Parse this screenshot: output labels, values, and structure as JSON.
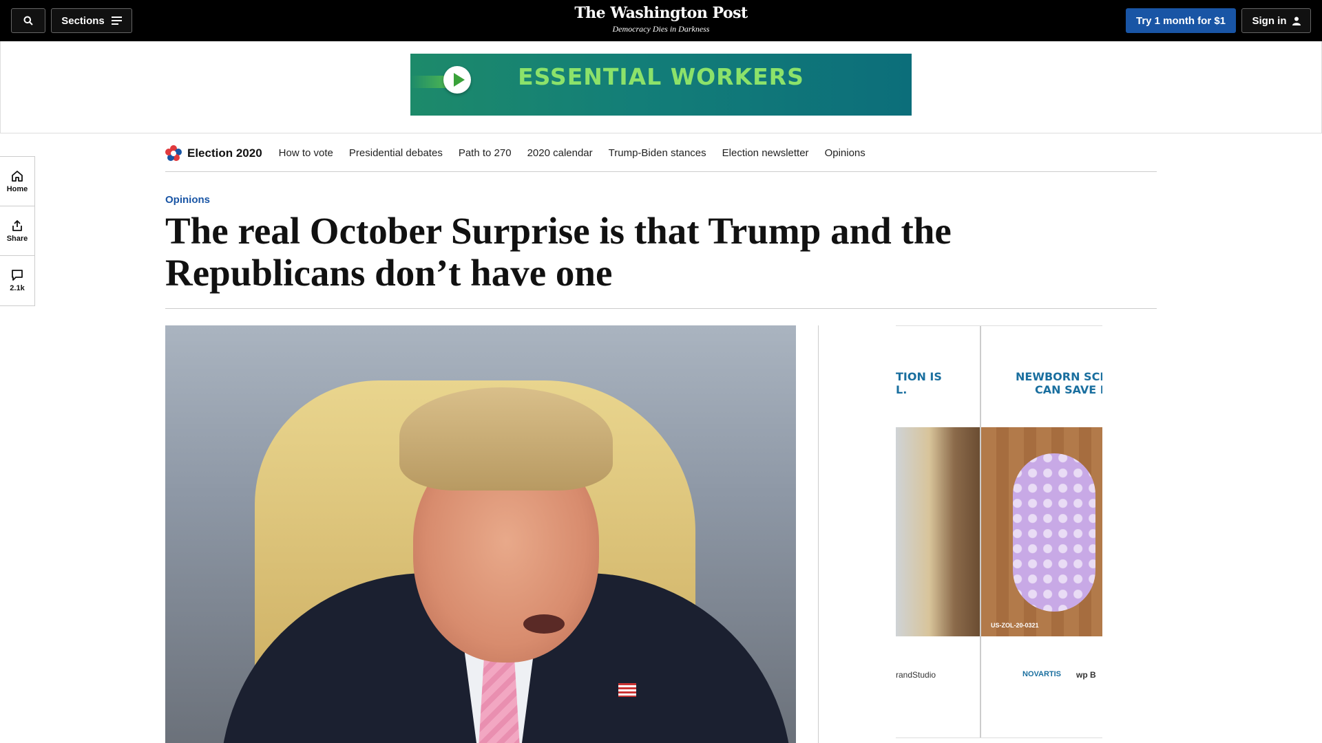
{
  "header": {
    "sections_label": "Sections",
    "logo_name": "The Washington Post",
    "logo_tagline": "Democracy Dies in Darkness",
    "subscribe_label": "Try 1 month for $1",
    "signin_label": "Sign in"
  },
  "top_ad": {
    "text": "ESSENTIAL WORKERS",
    "colors": {
      "bg_start": "#1d8a6a",
      "bg_end": "#0c6e7a",
      "text": "#8ce26a"
    }
  },
  "election_nav": {
    "title": "Election 2020",
    "items": [
      "How to vote",
      "Presidential debates",
      "Path to 270",
      "2020 calendar",
      "Trump-Biden stances",
      "Election newsletter",
      "Opinions"
    ]
  },
  "side_rail": {
    "home_label": "Home",
    "share_label": "Share",
    "comments_count": "2.1k"
  },
  "article": {
    "kicker": "Opinions",
    "headline": "The real October Surprise is that Trump and the Republicans don’t have one"
  },
  "side_ad": {
    "left_headline_line1": "TION IS",
    "left_headline_line2": "L.",
    "right_headline_line1": "NEWBORN SCR",
    "right_headline_line2": "CAN SAVE L",
    "code": "US-ZOL-20-0321",
    "left_footer": "randStudio",
    "right_footer_brand": "NOVARTIS",
    "right_footer_mark": "wp B"
  },
  "colors": {
    "brand_blue": "#1955a5",
    "topbar": "#000000",
    "ad_headline": "#1a6f9f"
  }
}
